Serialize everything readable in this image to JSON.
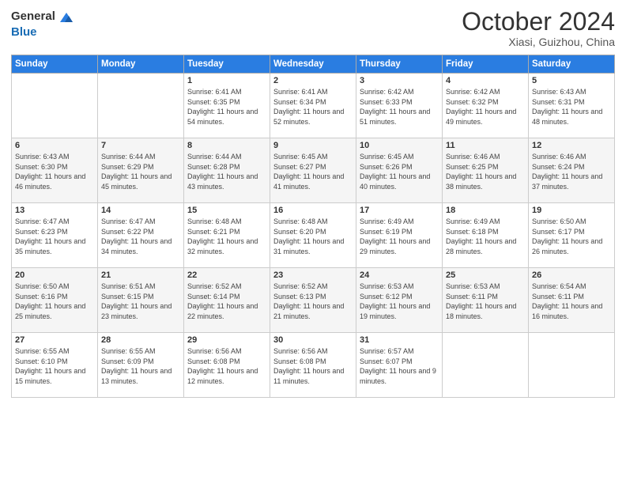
{
  "logo": {
    "general": "General",
    "blue": "Blue"
  },
  "title": {
    "month": "October 2024",
    "location": "Xiasi, Guizhou, China"
  },
  "weekdays": [
    "Sunday",
    "Monday",
    "Tuesday",
    "Wednesday",
    "Thursday",
    "Friday",
    "Saturday"
  ],
  "weeks": [
    [
      {
        "day": "",
        "sunrise": "",
        "sunset": "",
        "daylight": ""
      },
      {
        "day": "",
        "sunrise": "",
        "sunset": "",
        "daylight": ""
      },
      {
        "day": "1",
        "sunrise": "Sunrise: 6:41 AM",
        "sunset": "Sunset: 6:35 PM",
        "daylight": "Daylight: 11 hours and 54 minutes."
      },
      {
        "day": "2",
        "sunrise": "Sunrise: 6:41 AM",
        "sunset": "Sunset: 6:34 PM",
        "daylight": "Daylight: 11 hours and 52 minutes."
      },
      {
        "day": "3",
        "sunrise": "Sunrise: 6:42 AM",
        "sunset": "Sunset: 6:33 PM",
        "daylight": "Daylight: 11 hours and 51 minutes."
      },
      {
        "day": "4",
        "sunrise": "Sunrise: 6:42 AM",
        "sunset": "Sunset: 6:32 PM",
        "daylight": "Daylight: 11 hours and 49 minutes."
      },
      {
        "day": "5",
        "sunrise": "Sunrise: 6:43 AM",
        "sunset": "Sunset: 6:31 PM",
        "daylight": "Daylight: 11 hours and 48 minutes."
      }
    ],
    [
      {
        "day": "6",
        "sunrise": "Sunrise: 6:43 AM",
        "sunset": "Sunset: 6:30 PM",
        "daylight": "Daylight: 11 hours and 46 minutes."
      },
      {
        "day": "7",
        "sunrise": "Sunrise: 6:44 AM",
        "sunset": "Sunset: 6:29 PM",
        "daylight": "Daylight: 11 hours and 45 minutes."
      },
      {
        "day": "8",
        "sunrise": "Sunrise: 6:44 AM",
        "sunset": "Sunset: 6:28 PM",
        "daylight": "Daylight: 11 hours and 43 minutes."
      },
      {
        "day": "9",
        "sunrise": "Sunrise: 6:45 AM",
        "sunset": "Sunset: 6:27 PM",
        "daylight": "Daylight: 11 hours and 41 minutes."
      },
      {
        "day": "10",
        "sunrise": "Sunrise: 6:45 AM",
        "sunset": "Sunset: 6:26 PM",
        "daylight": "Daylight: 11 hours and 40 minutes."
      },
      {
        "day": "11",
        "sunrise": "Sunrise: 6:46 AM",
        "sunset": "Sunset: 6:25 PM",
        "daylight": "Daylight: 11 hours and 38 minutes."
      },
      {
        "day": "12",
        "sunrise": "Sunrise: 6:46 AM",
        "sunset": "Sunset: 6:24 PM",
        "daylight": "Daylight: 11 hours and 37 minutes."
      }
    ],
    [
      {
        "day": "13",
        "sunrise": "Sunrise: 6:47 AM",
        "sunset": "Sunset: 6:23 PM",
        "daylight": "Daylight: 11 hours and 35 minutes."
      },
      {
        "day": "14",
        "sunrise": "Sunrise: 6:47 AM",
        "sunset": "Sunset: 6:22 PM",
        "daylight": "Daylight: 11 hours and 34 minutes."
      },
      {
        "day": "15",
        "sunrise": "Sunrise: 6:48 AM",
        "sunset": "Sunset: 6:21 PM",
        "daylight": "Daylight: 11 hours and 32 minutes."
      },
      {
        "day": "16",
        "sunrise": "Sunrise: 6:48 AM",
        "sunset": "Sunset: 6:20 PM",
        "daylight": "Daylight: 11 hours and 31 minutes."
      },
      {
        "day": "17",
        "sunrise": "Sunrise: 6:49 AM",
        "sunset": "Sunset: 6:19 PM",
        "daylight": "Daylight: 11 hours and 29 minutes."
      },
      {
        "day": "18",
        "sunrise": "Sunrise: 6:49 AM",
        "sunset": "Sunset: 6:18 PM",
        "daylight": "Daylight: 11 hours and 28 minutes."
      },
      {
        "day": "19",
        "sunrise": "Sunrise: 6:50 AM",
        "sunset": "Sunset: 6:17 PM",
        "daylight": "Daylight: 11 hours and 26 minutes."
      }
    ],
    [
      {
        "day": "20",
        "sunrise": "Sunrise: 6:50 AM",
        "sunset": "Sunset: 6:16 PM",
        "daylight": "Daylight: 11 hours and 25 minutes."
      },
      {
        "day": "21",
        "sunrise": "Sunrise: 6:51 AM",
        "sunset": "Sunset: 6:15 PM",
        "daylight": "Daylight: 11 hours and 23 minutes."
      },
      {
        "day": "22",
        "sunrise": "Sunrise: 6:52 AM",
        "sunset": "Sunset: 6:14 PM",
        "daylight": "Daylight: 11 hours and 22 minutes."
      },
      {
        "day": "23",
        "sunrise": "Sunrise: 6:52 AM",
        "sunset": "Sunset: 6:13 PM",
        "daylight": "Daylight: 11 hours and 21 minutes."
      },
      {
        "day": "24",
        "sunrise": "Sunrise: 6:53 AM",
        "sunset": "Sunset: 6:12 PM",
        "daylight": "Daylight: 11 hours and 19 minutes."
      },
      {
        "day": "25",
        "sunrise": "Sunrise: 6:53 AM",
        "sunset": "Sunset: 6:11 PM",
        "daylight": "Daylight: 11 hours and 18 minutes."
      },
      {
        "day": "26",
        "sunrise": "Sunrise: 6:54 AM",
        "sunset": "Sunset: 6:11 PM",
        "daylight": "Daylight: 11 hours and 16 minutes."
      }
    ],
    [
      {
        "day": "27",
        "sunrise": "Sunrise: 6:55 AM",
        "sunset": "Sunset: 6:10 PM",
        "daylight": "Daylight: 11 hours and 15 minutes."
      },
      {
        "day": "28",
        "sunrise": "Sunrise: 6:55 AM",
        "sunset": "Sunset: 6:09 PM",
        "daylight": "Daylight: 11 hours and 13 minutes."
      },
      {
        "day": "29",
        "sunrise": "Sunrise: 6:56 AM",
        "sunset": "Sunset: 6:08 PM",
        "daylight": "Daylight: 11 hours and 12 minutes."
      },
      {
        "day": "30",
        "sunrise": "Sunrise: 6:56 AM",
        "sunset": "Sunset: 6:08 PM",
        "daylight": "Daylight: 11 hours and 11 minutes."
      },
      {
        "day": "31",
        "sunrise": "Sunrise: 6:57 AM",
        "sunset": "Sunset: 6:07 PM",
        "daylight": "Daylight: 11 hours and 9 minutes."
      },
      {
        "day": "",
        "sunrise": "",
        "sunset": "",
        "daylight": ""
      },
      {
        "day": "",
        "sunrise": "",
        "sunset": "",
        "daylight": ""
      }
    ]
  ]
}
